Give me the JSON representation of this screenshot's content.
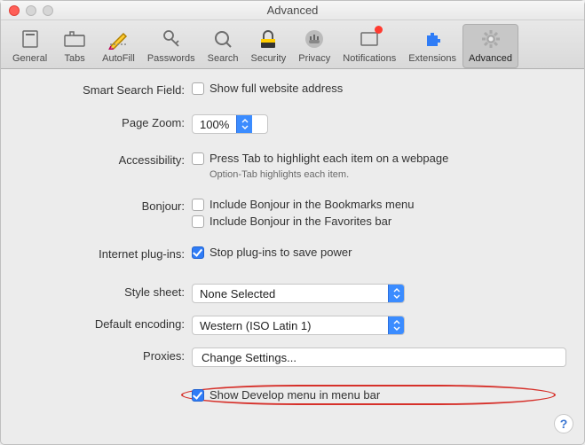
{
  "window": {
    "title": "Advanced"
  },
  "toolbar": [
    {
      "id": "general",
      "label": "General"
    },
    {
      "id": "tabs",
      "label": "Tabs"
    },
    {
      "id": "autofill",
      "label": "AutoFill"
    },
    {
      "id": "passwords",
      "label": "Passwords"
    },
    {
      "id": "search",
      "label": "Search"
    },
    {
      "id": "security",
      "label": "Security"
    },
    {
      "id": "privacy",
      "label": "Privacy"
    },
    {
      "id": "notifications",
      "label": "Notifications"
    },
    {
      "id": "extensions",
      "label": "Extensions"
    },
    {
      "id": "advanced",
      "label": "Advanced"
    }
  ],
  "labels": {
    "smartSearch": "Smart Search Field:",
    "pageZoom": "Page Zoom:",
    "accessibility": "Accessibility:",
    "bonjour": "Bonjour:",
    "plugins": "Internet plug-ins:",
    "stylesheet": "Style sheet:",
    "encoding": "Default encoding:",
    "proxies": "Proxies:"
  },
  "fields": {
    "showFullAddress": {
      "checked": false,
      "label": "Show full website address"
    },
    "pageZoom": {
      "value": "100%"
    },
    "pressTab": {
      "checked": false,
      "label": "Press Tab to highlight each item on a webpage",
      "hint": "Option-Tab highlights each item."
    },
    "bonjourBookmarks": {
      "checked": false,
      "label": "Include Bonjour in the Bookmarks menu"
    },
    "bonjourFavorites": {
      "checked": false,
      "label": "Include Bonjour in the Favorites bar"
    },
    "stopPlugins": {
      "checked": true,
      "label": "Stop plug-ins to save power"
    },
    "stylesheet": {
      "value": "None Selected"
    },
    "encoding": {
      "value": "Western (ISO Latin 1)"
    },
    "proxiesButton": {
      "label": "Change Settings..."
    },
    "showDevelop": {
      "checked": true,
      "label": "Show Develop menu in menu bar"
    }
  },
  "help": "?"
}
